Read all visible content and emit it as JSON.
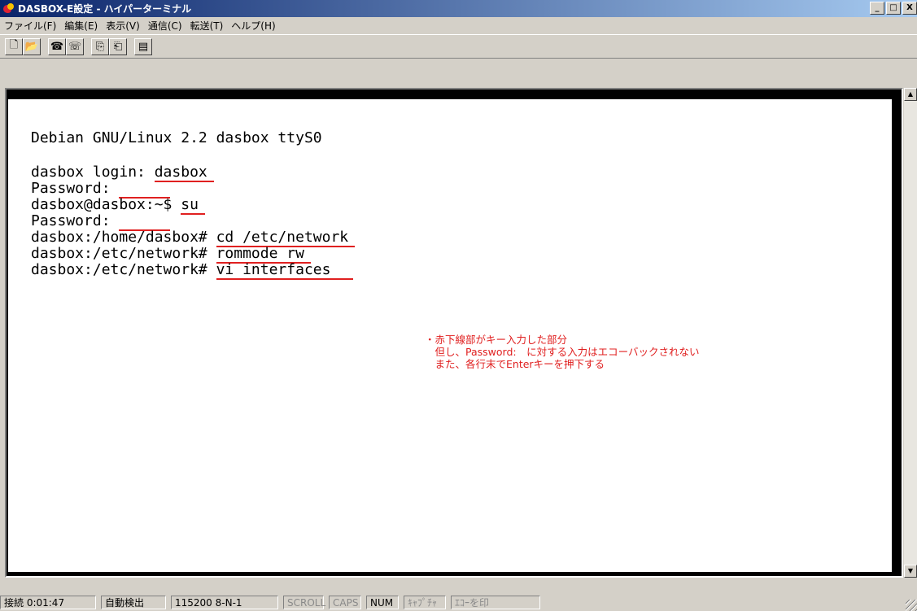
{
  "window": {
    "title": "DASBOX-E設定 - ハイパーターミナル",
    "controls": {
      "minimize": "_",
      "maximize": "□",
      "close": "X"
    }
  },
  "menu": [
    "ファイル(F)",
    "編集(E)",
    "表示(V)",
    "通信(C)",
    "転送(T)",
    "ヘルプ(H)"
  ],
  "toolbar": [
    {
      "name": "new-icon",
      "glyph": "🗋"
    },
    {
      "name": "open-icon",
      "glyph": "📂"
    },
    {
      "name": "connect-icon",
      "glyph": "☎"
    },
    {
      "name": "disconnect-icon",
      "glyph": "☏"
    },
    {
      "name": "send-icon",
      "glyph": "⎘"
    },
    {
      "name": "receive-icon",
      "glyph": "⎗"
    },
    {
      "name": "properties-icon",
      "glyph": "▤"
    }
  ],
  "terminal": {
    "banner": "Debian GNU/Linux 2.2 dasbox ttyS0",
    "lines": [
      {
        "prompt": "dasbox login: ",
        "input": "dasbox"
      },
      {
        "prompt": "Password: ",
        "input": "     "
      },
      {
        "prompt": "dasbox@dasbox:~$ ",
        "input": "su"
      },
      {
        "prompt": "Password: ",
        "input": "     "
      },
      {
        "prompt": "dasbox:/home/dasbox# ",
        "input": "cd /etc/network"
      },
      {
        "prompt": "dasbox:/etc/network# ",
        "input": "rommode rw"
      },
      {
        "prompt": "dasbox:/etc/network# ",
        "input": "vi interfaces"
      }
    ],
    "note": [
      "・赤下線部がキー入力した部分",
      "　但し、Password:　に対する入力はエコーバックされない",
      "　また、各行末でEnterキーを押下する"
    ],
    "accent_color": "#e02020"
  },
  "status": {
    "connected": "接続 0:01:47",
    "detect": "自動検出",
    "port": "115200 8-N-1",
    "scroll": "SCROLL",
    "caps": "CAPS",
    "num": "NUM",
    "capture": "ｷｬﾌﾟﾁｬ",
    "echo": "ｴｺｰを印"
  }
}
